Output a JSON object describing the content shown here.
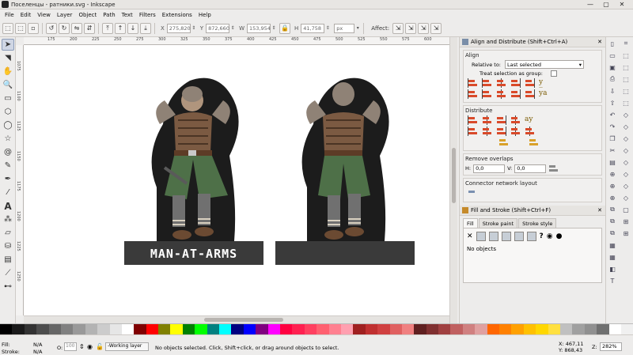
{
  "window": {
    "title": "Поселенцы - ратники.svg - Inkscape"
  },
  "menu": [
    "File",
    "Edit",
    "View",
    "Layer",
    "Object",
    "Path",
    "Text",
    "Filters",
    "Extensions",
    "Help"
  ],
  "toolctrl": {
    "x_label": "X",
    "x_value": "275,820",
    "y_label": "Y",
    "y_value": "872,660",
    "w_label": "W",
    "w_value": "153,954",
    "h_label": "H",
    "h_value": "41,758",
    "unit": "px",
    "affect_label": "Affect:"
  },
  "ruler": {
    "top_ticks": [
      "175",
      "200",
      "225",
      "250",
      "275",
      "300",
      "325",
      "350",
      "375",
      "400",
      "425",
      "450",
      "475",
      "500",
      "525",
      "550",
      "575",
      "600",
      "625",
      "650"
    ],
    "left_ticks": [
      "1075",
      "1100",
      "1125",
      "1150",
      "1175",
      "1200",
      "1225",
      "1250",
      "1275"
    ]
  },
  "canvas": {
    "token1_label": "MAN-AT-ARMS"
  },
  "align": {
    "header": "Align and Distribute (Shift+Ctrl+A)",
    "align_title": "Align",
    "relative_label": "Relative to:",
    "relative_value": "Last selected",
    "treat_group_label": "Treat selection as group:",
    "distribute_title": "Distribute",
    "overlap_title": "Remove overlaps",
    "h_label": "H:",
    "h_value": "0,0",
    "v_label": "V:",
    "v_value": "0,0",
    "connector_title": "Connector network layout"
  },
  "fill": {
    "header": "Fill and Stroke (Shift+Ctrl+F)",
    "tab_fill": "Fill",
    "tab_stroke_paint": "Stroke paint",
    "tab_stroke_style": "Stroke style",
    "no_objects": "No objects"
  },
  "status": {
    "fill_label": "Fill:",
    "fill_value": "N/A",
    "stroke_label": "Stroke:",
    "stroke_value": "N/A",
    "opacity_label": "O:",
    "opacity_value": "100",
    "layer": "-Working layer",
    "message": "No objects selected. Click, Shift+click, or drag around objects to select.",
    "x_coord": "X: 467,11",
    "y_coord": "Y: 868,43",
    "zoom_label": "Z:",
    "zoom_value": "282%"
  },
  "palette_colors": [
    "#000000",
    "#1a1a1a",
    "#333333",
    "#4d4d4d",
    "#666666",
    "#808080",
    "#999999",
    "#b3b3b3",
    "#cccccc",
    "#e6e6e6",
    "#ffffff",
    "#800000",
    "#ff0000",
    "#808000",
    "#ffff00",
    "#008000",
    "#00ff00",
    "#008080",
    "#00ffff",
    "#000080",
    "#0000ff",
    "#800080",
    "#ff00ff",
    "#ff0040",
    "#ff2050",
    "#ff4060",
    "#ff6070",
    "#ff8090",
    "#ffa0b0",
    "#a02020",
    "#c03030",
    "#d04040",
    "#e06060",
    "#f08080",
    "#602020",
    "#803030",
    "#a04040",
    "#c06060",
    "#d08080",
    "#e0a0a0",
    "#ff6600",
    "#ff8000",
    "#ffa000",
    "#ffc000",
    "#ffd700",
    "#ffe040",
    "#c0c0c0",
    "#a0a0a0",
    "#909090",
    "#707070",
    "#ffffff",
    "#f0f0f0"
  ]
}
